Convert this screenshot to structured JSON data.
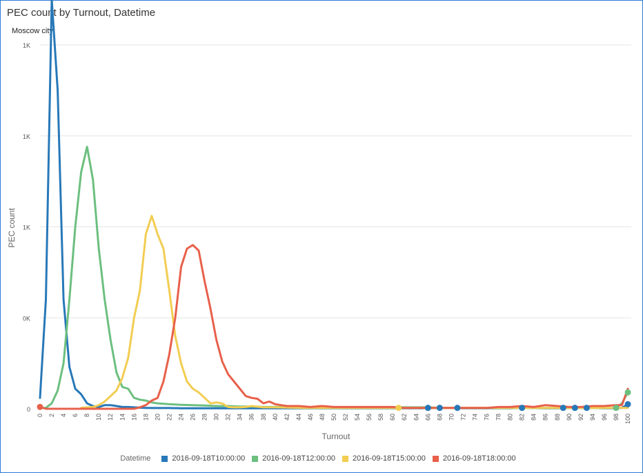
{
  "window": {
    "title": "PEC count by Turnout, Datetime",
    "subtitle": "Moscow city"
  },
  "legend": {
    "title": "Datetime"
  },
  "chart_data": {
    "type": "line",
    "title": "PEC count by Turnout, Datetime",
    "subtitle": "Moscow city",
    "xlabel": "Turnout",
    "ylabel": "PEC count",
    "xlim": [
      0,
      100
    ],
    "ylim": [
      0,
      2000
    ],
    "x_ticks": [
      0,
      2,
      4,
      6,
      8,
      10,
      12,
      14,
      16,
      18,
      20,
      22,
      24,
      26,
      28,
      30,
      32,
      34,
      36,
      38,
      40,
      42,
      44,
      46,
      48,
      50,
      52,
      54,
      56,
      58,
      60,
      62,
      64,
      66,
      68,
      70,
      72,
      74,
      76,
      78,
      80,
      82,
      84,
      86,
      88,
      90,
      92,
      94,
      96,
      98,
      100
    ],
    "y_ticks": [
      0,
      500,
      1000,
      1500,
      2000
    ],
    "y_tick_labels": [
      "0",
      "0K",
      "1K",
      "1K",
      "1K"
    ],
    "grid": true,
    "legend_position": "bottom",
    "series": [
      {
        "name": "2016-09-18T10:00:00",
        "color": "#2778b8",
        "x": [
          0,
          1,
          2,
          3,
          4,
          5,
          6,
          7,
          8,
          9,
          10,
          11,
          12,
          13,
          14,
          15,
          16,
          17,
          18,
          19,
          20,
          22,
          24,
          26,
          28,
          30,
          32,
          34,
          36,
          38,
          40,
          45,
          50,
          55,
          60,
          65,
          66,
          68,
          70,
          72,
          76,
          80,
          82,
          86,
          88,
          90,
          92,
          94,
          96,
          98,
          99,
          100
        ],
        "y": [
          60,
          600,
          2250,
          1750,
          600,
          230,
          110,
          80,
          30,
          15,
          10,
          20,
          20,
          15,
          10,
          10,
          8,
          6,
          5,
          4,
          4,
          4,
          3,
          3,
          3,
          3,
          3,
          3,
          3,
          3,
          3,
          3,
          3,
          3,
          3,
          3,
          5,
          5,
          5,
          3,
          3,
          3,
          5,
          3,
          3,
          5,
          5,
          5,
          3,
          3,
          5,
          25
        ],
        "markers": [
          {
            "x": 66,
            "y": 5
          },
          {
            "x": 68,
            "y": 5
          },
          {
            "x": 71,
            "y": 5
          },
          {
            "x": 82,
            "y": 5
          },
          {
            "x": 89,
            "y": 5
          },
          {
            "x": 91,
            "y": 5
          },
          {
            "x": 93,
            "y": 5
          },
          {
            "x": 100,
            "y": 25
          }
        ]
      },
      {
        "name": "2016-09-18T12:00:00",
        "color": "#6cbf7f",
        "x": [
          0,
          1,
          2,
          3,
          4,
          5,
          6,
          7,
          8,
          9,
          10,
          11,
          12,
          13,
          14,
          15,
          16,
          17,
          18,
          19,
          20,
          22,
          24,
          26,
          28,
          30,
          32,
          34,
          36,
          38,
          40,
          45,
          50,
          55,
          60,
          65,
          70,
          75,
          80,
          85,
          90,
          95,
          98,
          99,
          100
        ],
        "y": [
          5,
          5,
          30,
          100,
          250,
          600,
          1000,
          1300,
          1440,
          1260,
          880,
          600,
          380,
          200,
          120,
          110,
          60,
          50,
          45,
          35,
          30,
          25,
          22,
          20,
          18,
          15,
          15,
          12,
          12,
          10,
          10,
          10,
          8,
          8,
          8,
          8,
          5,
          5,
          5,
          5,
          5,
          5,
          5,
          30,
          90
        ],
        "markers": [
          {
            "x": 98,
            "y": 5
          },
          {
            "x": 100,
            "y": 90
          }
        ]
      },
      {
        "name": "2016-09-18T15:00:00",
        "color": "#f2cd52",
        "x": [
          7,
          8,
          9,
          10,
          11,
          12,
          13,
          14,
          15,
          16,
          17,
          18,
          19,
          20,
          21,
          22,
          23,
          24,
          25,
          26,
          27,
          28,
          29,
          30,
          31,
          32,
          33,
          34,
          35,
          36,
          38,
          40,
          45,
          50,
          55,
          60,
          65,
          70,
          75,
          80,
          85,
          90,
          95,
          100
        ],
        "y": [
          5,
          8,
          10,
          20,
          40,
          70,
          100,
          170,
          280,
          500,
          650,
          960,
          1060,
          960,
          880,
          650,
          400,
          250,
          150,
          110,
          90,
          60,
          30,
          35,
          30,
          10,
          8,
          8,
          10,
          15,
          8,
          8,
          5,
          5,
          5,
          5,
          5,
          5,
          5,
          5,
          5,
          5,
          5,
          5
        ],
        "markers": [
          {
            "x": 61,
            "y": 5
          }
        ]
      },
      {
        "name": "2016-09-18T18:00:00",
        "color": "#e8604a",
        "x": [
          0,
          1,
          2,
          3,
          4,
          5,
          6,
          7,
          8,
          9,
          10,
          11,
          12,
          13,
          14,
          15,
          16,
          17,
          18,
          19,
          20,
          21,
          22,
          23,
          24,
          25,
          26,
          27,
          28,
          29,
          30,
          31,
          32,
          33,
          34,
          35,
          36,
          37,
          38,
          39,
          40,
          41,
          42,
          44,
          46,
          48,
          50,
          52,
          54,
          56,
          58,
          60,
          62,
          64,
          66,
          68,
          70,
          72,
          74,
          76,
          78,
          80,
          82,
          84,
          86,
          88,
          90,
          92,
          94,
          96,
          98,
          99,
          100
        ],
        "y": [
          10,
          0,
          0,
          0,
          0,
          0,
          0,
          0,
          0,
          0,
          0,
          0,
          0,
          0,
          0,
          0,
          0,
          8,
          20,
          45,
          60,
          150,
          300,
          500,
          780,
          880,
          900,
          870,
          700,
          550,
          380,
          260,
          190,
          150,
          110,
          70,
          60,
          55,
          30,
          40,
          25,
          20,
          15,
          15,
          10,
          15,
          10,
          10,
          10,
          10,
          10,
          10,
          5,
          5,
          5,
          5,
          5,
          5,
          5,
          5,
          10,
          10,
          15,
          10,
          20,
          15,
          10,
          10,
          15,
          15,
          20,
          20,
          110
        ],
        "markers": [
          {
            "x": 0,
            "y": 10
          }
        ]
      }
    ]
  }
}
